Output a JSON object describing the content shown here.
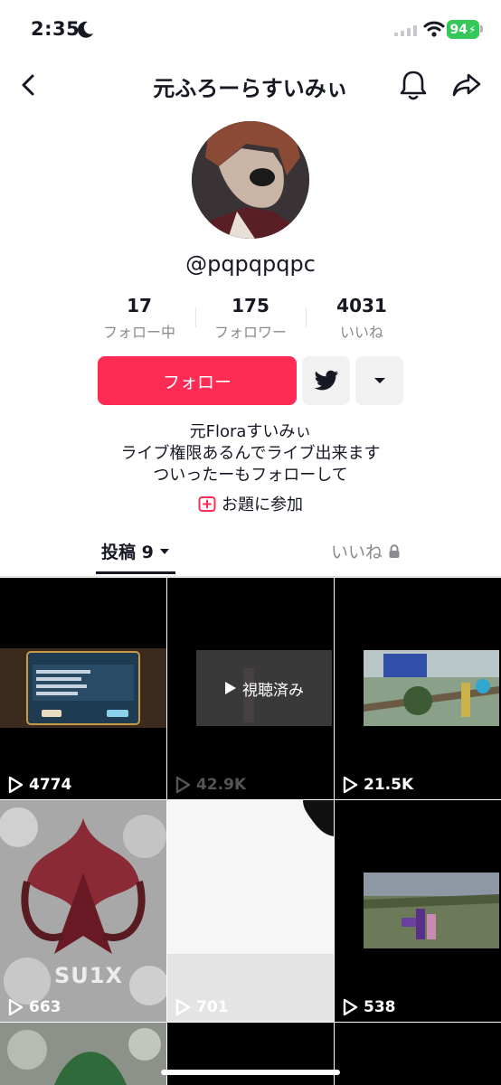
{
  "status": {
    "time": "2:35",
    "battery": "94"
  },
  "nav": {
    "title": "元ふろーらすいみぃ"
  },
  "profile": {
    "handle": "@pqpqpqpc",
    "stats": [
      {
        "value": "17",
        "label": "フォロー中"
      },
      {
        "value": "175",
        "label": "フォロワー"
      },
      {
        "value": "4031",
        "label": "いいね"
      }
    ],
    "follow_label": "フォロー",
    "bio": [
      "元Floraすいみぃ",
      "ライブ権限あるんでライブ出来ます",
      "ついったーもフォローして"
    ],
    "topic_label": "お題に参加"
  },
  "tabs": {
    "posts": "投稿 9",
    "likes": "いいね"
  },
  "videos": [
    {
      "count": "4774"
    },
    {
      "count": "42.9K",
      "watched_label": "視聴済み"
    },
    {
      "count": "21.5K"
    },
    {
      "count": "663",
      "overlay_text": "SU1X"
    },
    {
      "count": "701"
    },
    {
      "count": "538"
    }
  ],
  "colors": {
    "accent": "#fe2c55",
    "battery": "#34c759",
    "text": "#161823",
    "muted": "#8a8b91"
  }
}
